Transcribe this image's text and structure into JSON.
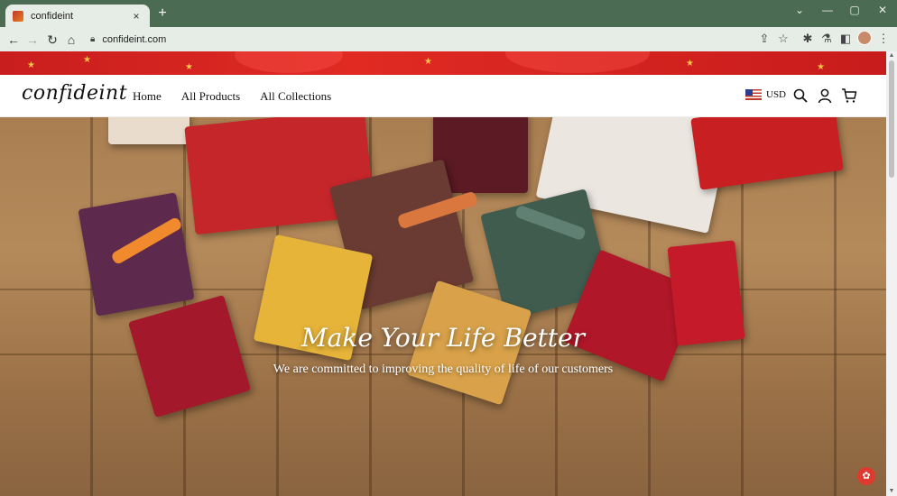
{
  "browser": {
    "tab_title": "confideint",
    "url": "confideint.com",
    "new_tab_glyph": "+",
    "close_tab_glyph": "×"
  },
  "site": {
    "logo": "confideint",
    "nav": [
      "Home",
      "All Products",
      "All Collections"
    ],
    "currency": "USD",
    "icons": [
      "search-icon",
      "account-icon",
      "cart-icon"
    ]
  },
  "hero": {
    "title": "Make Your Life Better",
    "subtitle": "We are committed to improving the quality of life of our customers"
  },
  "colors": {
    "browser_frame": "#4b6b53",
    "promo_bar": "#d42420",
    "hero_wood": "#a97f52",
    "chat_button": "#e03a2f"
  }
}
